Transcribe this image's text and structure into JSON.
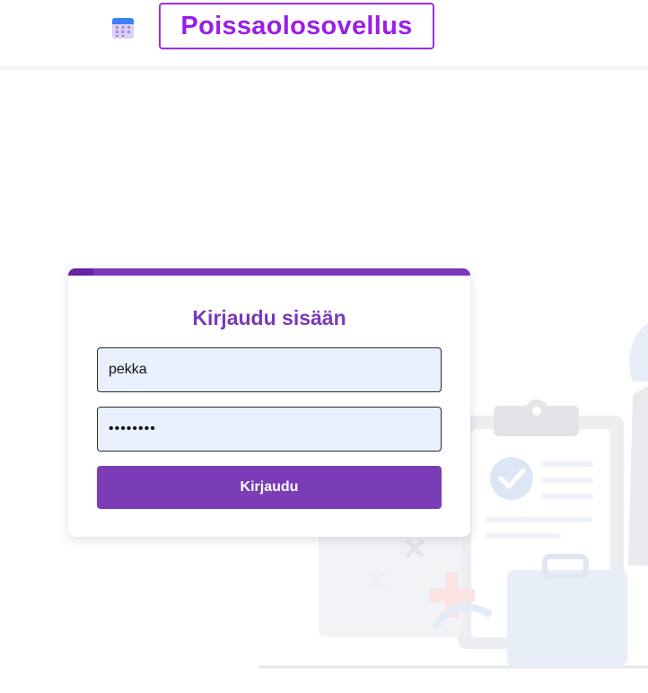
{
  "header": {
    "app_icon": "calendar-icon",
    "title": "Poissaolosovellus"
  },
  "login": {
    "title": "Kirjaudu sisään",
    "username_value": "pekka",
    "password_value": "pekka123",
    "submit_label": "Kirjaudu"
  },
  "colors": {
    "accent": "#7b3cb8",
    "title_purple": "#9a1ee6",
    "input_bg": "#e8effd"
  }
}
